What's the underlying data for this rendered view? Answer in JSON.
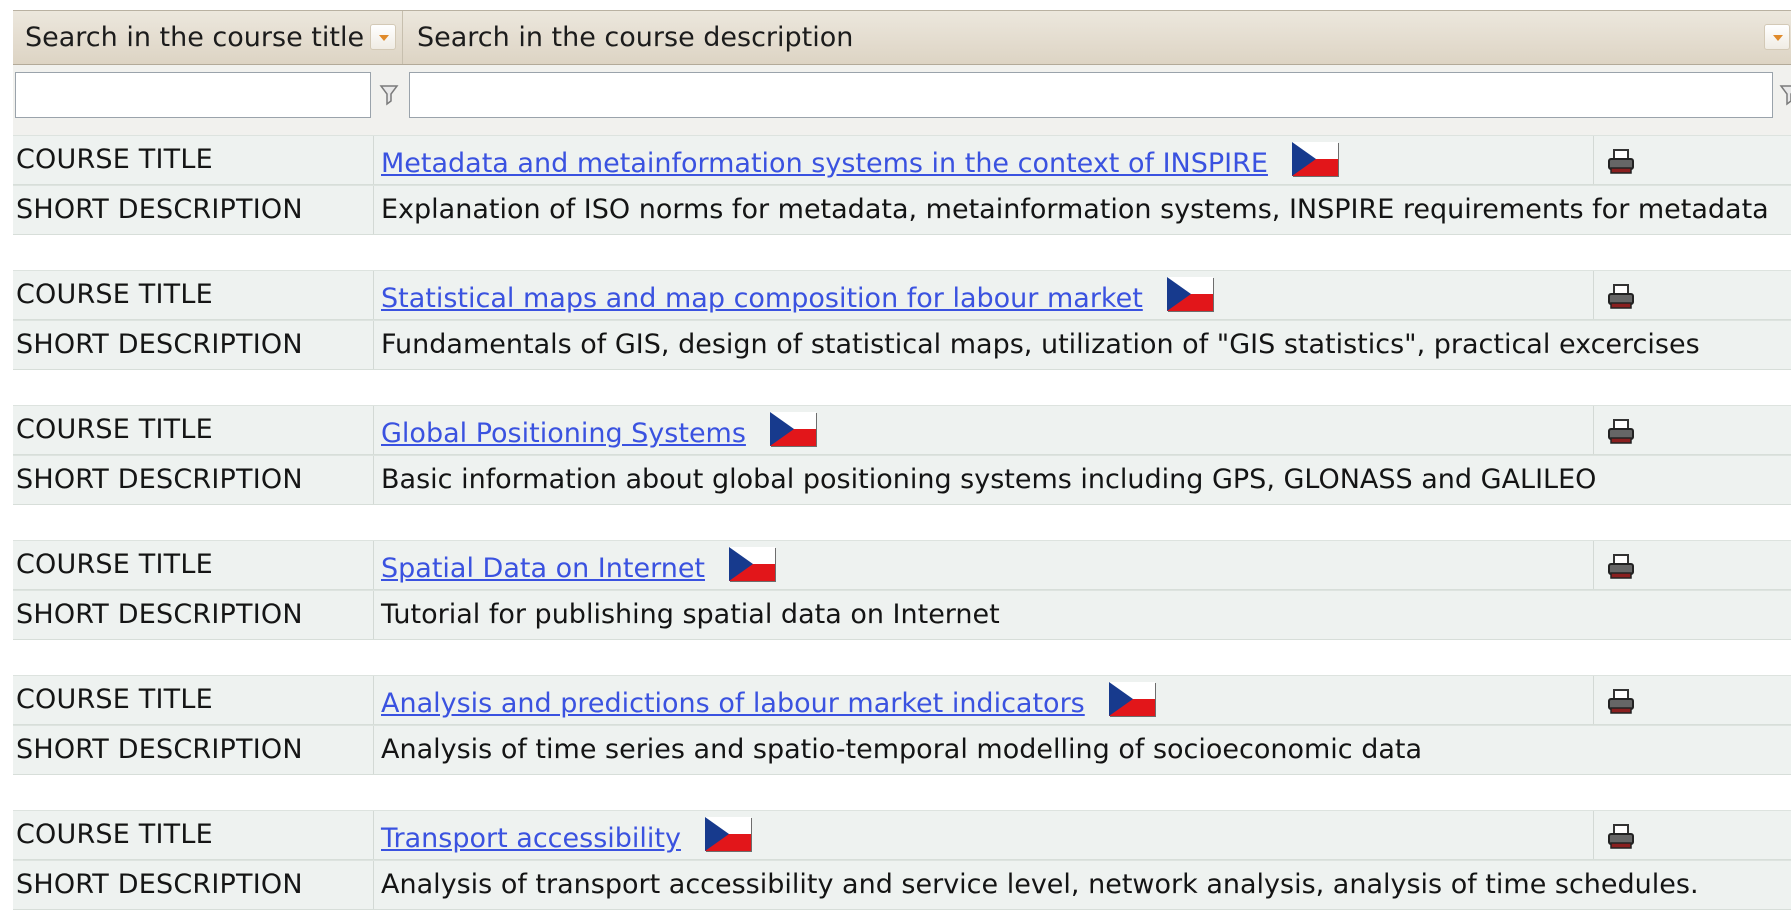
{
  "header": {
    "col_title": "Search in the course title",
    "col_desc": "Search in the course description"
  },
  "filters": {
    "title_value": "",
    "desc_value": ""
  },
  "colors": {
    "link": "#3a52e0",
    "header_bg": "#e3dccf",
    "row_bg": "#eef2f0"
  },
  "labels": {
    "course_title": "COURSE TITLE",
    "short_description": "SHORT DESCRIPTION"
  },
  "courses": [
    {
      "title": "Metadata and metainformation systems in the context of INSPIRE",
      "description": "Explanation of ISO norms for metadata, metainformation systems, INSPIRE requirements for metadata",
      "flag": "czech-flag-icon",
      "action": "printer-icon"
    },
    {
      "title": "Statistical maps and map composition for labour market",
      "description": "Fundamentals of GIS, design of statistical maps, utilization of \"GIS statistics\", practical excercises",
      "flag": "czech-flag-icon",
      "action": "printer-icon"
    },
    {
      "title": "Global Positioning Systems",
      "description": "Basic information about global positioning systems including GPS, GLONASS and GALILEO",
      "flag": "czech-flag-icon",
      "action": "printer-icon"
    },
    {
      "title": "Spatial Data on Internet",
      "description": "Tutorial for publishing spatial data on Internet",
      "flag": "czech-flag-icon",
      "action": "printer-icon"
    },
    {
      "title": "Analysis and predictions of labour market indicators",
      "description": "Analysis of time series and spatio-temporal modelling of socioeconomic data",
      "flag": "czech-flag-icon",
      "action": "printer-icon"
    },
    {
      "title": "Transport accessibility",
      "description": "Analysis of transport accessibility and service level, network analysis, analysis of time schedules.",
      "flag": "czech-flag-icon",
      "action": "printer-icon"
    }
  ]
}
